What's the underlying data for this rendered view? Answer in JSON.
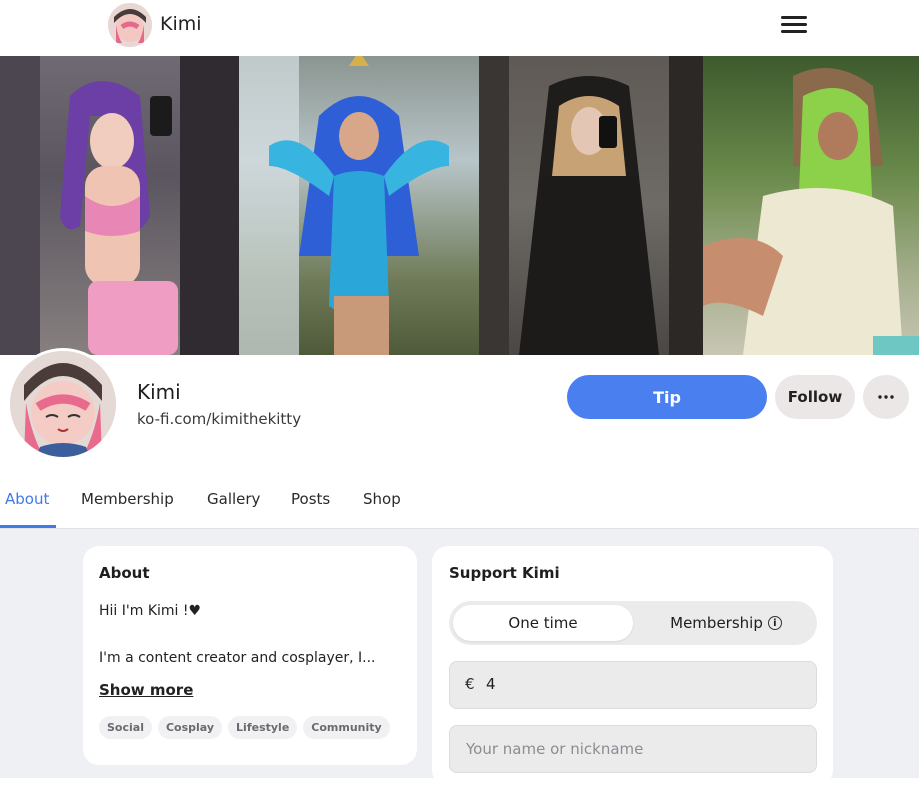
{
  "header": {
    "brand": "Kimi",
    "menu_icon": "hamburger-menu-icon"
  },
  "banner": {
    "panels": [
      "cosplay-photo-1",
      "cosplay-photo-2",
      "cosplay-photo-3",
      "cosplay-photo-4"
    ]
  },
  "profile": {
    "name": "Kimi",
    "handle": "ko-fi.com/kimithekitty",
    "tip_label": "Tip",
    "follow_label": "Follow",
    "more_icon": "ellipsis-icon"
  },
  "tabs": [
    {
      "label": "About",
      "active": true
    },
    {
      "label": "Membership",
      "active": false
    },
    {
      "label": "Gallery",
      "active": false
    },
    {
      "label": "Posts",
      "active": false
    },
    {
      "label": "Shop",
      "active": false
    }
  ],
  "about": {
    "title": "About",
    "line1": "Hii I'm Kimi !♥",
    "line2": "I'm a content creator and cosplayer, I...",
    "show_more": "Show more",
    "tags": [
      "Social",
      "Cosplay",
      "Lifestyle",
      "Community"
    ]
  },
  "support": {
    "title": "Support Kimi",
    "option_one_time": "One time",
    "option_membership": "Membership",
    "currency": "€",
    "amount": "4",
    "name_placeholder": "Your name or nickname"
  },
  "colors": {
    "accent": "#4a7ff0",
    "active_tab": "#3e7ae8",
    "page_bg": "#eef0f4"
  }
}
